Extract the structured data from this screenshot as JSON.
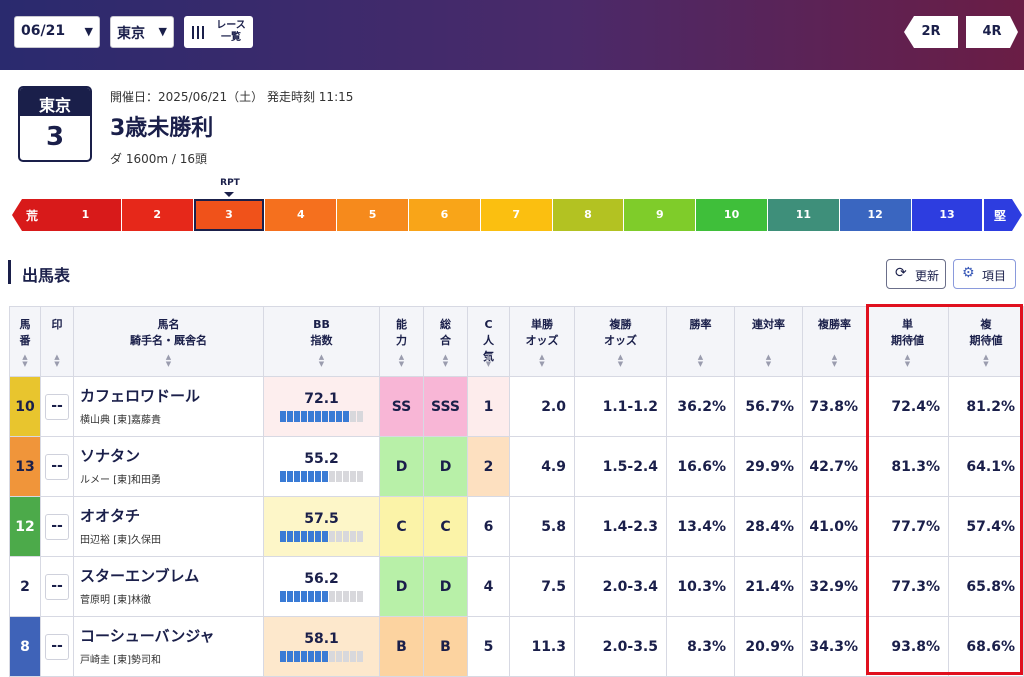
{
  "header": {
    "date_select": "06/21",
    "venue_select": "東京",
    "race_list_label": "レース一覧",
    "prev_race": "2R",
    "next_race": "4R"
  },
  "race": {
    "venue": "東京",
    "number": "3",
    "date_line": "開催日：2025/06/21（土） 発走時刻 11:15",
    "name": "3歳未勝利",
    "distance_line": "ダ 1600m / 16頭"
  },
  "rpt": {
    "label": "RPT",
    "selected": 3,
    "left_end": "荒",
    "right_end": "堅",
    "segments": [
      "1",
      "2",
      "3",
      "4",
      "5",
      "6",
      "7",
      "8",
      "9",
      "10",
      "11",
      "12",
      "13"
    ],
    "colors": [
      "#d81a1a",
      "#e6281a",
      "#f0521a",
      "#f5701e",
      "#f68a1c",
      "#f9a518",
      "#fbbf10",
      "#b3c222",
      "#7fcc2a",
      "#3fbf3a",
      "#3e8f7a",
      "#3a66c0",
      "#2d3de0"
    ],
    "left_end_color": "#d81a1a",
    "right_end_color": "#2d3de0"
  },
  "section": {
    "title": "出馬表",
    "update_label": "更新",
    "columns_label": "項目"
  },
  "columns": [
    {
      "key": "umaban",
      "label": "馬番"
    },
    {
      "key": "mark",
      "label": "印"
    },
    {
      "key": "horse",
      "label": "馬名 騎手名・厩舎名"
    },
    {
      "key": "bb",
      "label": "BB 指数"
    },
    {
      "key": "ability",
      "label": "能力"
    },
    {
      "key": "overall",
      "label": "総合"
    },
    {
      "key": "c_pop",
      "label": "C人気"
    },
    {
      "key": "win_odds",
      "label": "単勝 オッズ"
    },
    {
      "key": "place_odds",
      "label": "複勝 オッズ"
    },
    {
      "key": "win_rate",
      "label": "勝率"
    },
    {
      "key": "quinella_rate",
      "label": "連対率"
    },
    {
      "key": "place_rate",
      "label": "複勝率"
    },
    {
      "key": "win_ev",
      "label": "単 期待値"
    },
    {
      "key": "place_ev",
      "label": "複 期待値"
    }
  ],
  "rows": [
    {
      "umaban": "10",
      "frame_color": "#e8c52e",
      "mark": "--",
      "horse": "カフェロワドール",
      "jockey": "横山典 [東]嘉藤貴",
      "bb": "72.1",
      "bb_level": 10,
      "bb_bg": "#fdeeee",
      "ability": "SS",
      "ability_bg": "#f8b6d6",
      "overall": "SSS",
      "overall_bg": "#f8b6d6",
      "c_pop": "1",
      "c_pop_bg": "#fdecec",
      "win_odds": "2.0",
      "place_odds": "1.1-1.2",
      "win_rate": "36.2%",
      "quinella_rate": "56.7%",
      "place_rate": "73.8%",
      "win_ev": "72.4%",
      "place_ev": "81.2%"
    },
    {
      "umaban": "13",
      "frame_color": "#f0953a",
      "mark": "--",
      "horse": "ソナタン",
      "jockey": "ルメー [東]和田勇",
      "bb": "55.2",
      "bb_level": 7,
      "bb_bg": "#ffffff",
      "ability": "D",
      "ability_bg": "#b8f0a8",
      "overall": "D",
      "overall_bg": "#b8f0a8",
      "c_pop": "2",
      "c_pop_bg": "#fde0c0",
      "win_odds": "4.9",
      "place_odds": "1.5-2.4",
      "win_rate": "16.6%",
      "quinella_rate": "29.9%",
      "place_rate": "42.7%",
      "win_ev": "81.3%",
      "place_ev": "64.1%"
    },
    {
      "umaban": "12",
      "frame_color": "#4caa4a",
      "mark": "--",
      "horse": "オオタチ",
      "jockey": "田辺裕 [東]久保田",
      "bb": "57.5",
      "bb_level": 7,
      "bb_bg": "#fdf6c8",
      "ability": "C",
      "ability_bg": "#fbf3a8",
      "overall": "C",
      "overall_bg": "#fbf3a8",
      "c_pop": "6",
      "c_pop_bg": "#ffffff",
      "win_odds": "5.8",
      "place_odds": "1.4-2.3",
      "win_rate": "13.4%",
      "quinella_rate": "28.4%",
      "place_rate": "41.0%",
      "win_ev": "77.7%",
      "place_ev": "57.4%"
    },
    {
      "umaban": "2",
      "frame_color": "#ffffff",
      "mark": "--",
      "horse": "スターエンブレム",
      "jockey": "菅原明 [東]林徹",
      "bb": "56.2",
      "bb_level": 7,
      "bb_bg": "#ffffff",
      "ability": "D",
      "ability_bg": "#b8f0a8",
      "overall": "D",
      "overall_bg": "#b8f0a8",
      "c_pop": "4",
      "c_pop_bg": "#ffffff",
      "win_odds": "7.5",
      "place_odds": "2.0-3.4",
      "win_rate": "10.3%",
      "quinella_rate": "21.4%",
      "place_rate": "32.9%",
      "win_ev": "77.3%",
      "place_ev": "65.8%"
    },
    {
      "umaban": "8",
      "frame_color": "#3f63b8",
      "mark": "--",
      "horse": "コーシューバンジャ",
      "jockey": "戸崎圭 [東]勢司和",
      "bb": "58.1",
      "bb_level": 7,
      "bb_bg": "#fde8cc",
      "ability": "B",
      "ability_bg": "#fcd3a0",
      "overall": "B",
      "overall_bg": "#fcd3a0",
      "c_pop": "5",
      "c_pop_bg": "#ffffff",
      "win_odds": "11.3",
      "place_odds": "2.0-3.5",
      "win_rate": "8.3%",
      "quinella_rate": "20.9%",
      "place_rate": "34.3%",
      "win_ev": "93.8%",
      "place_ev": "68.6%"
    }
  ]
}
